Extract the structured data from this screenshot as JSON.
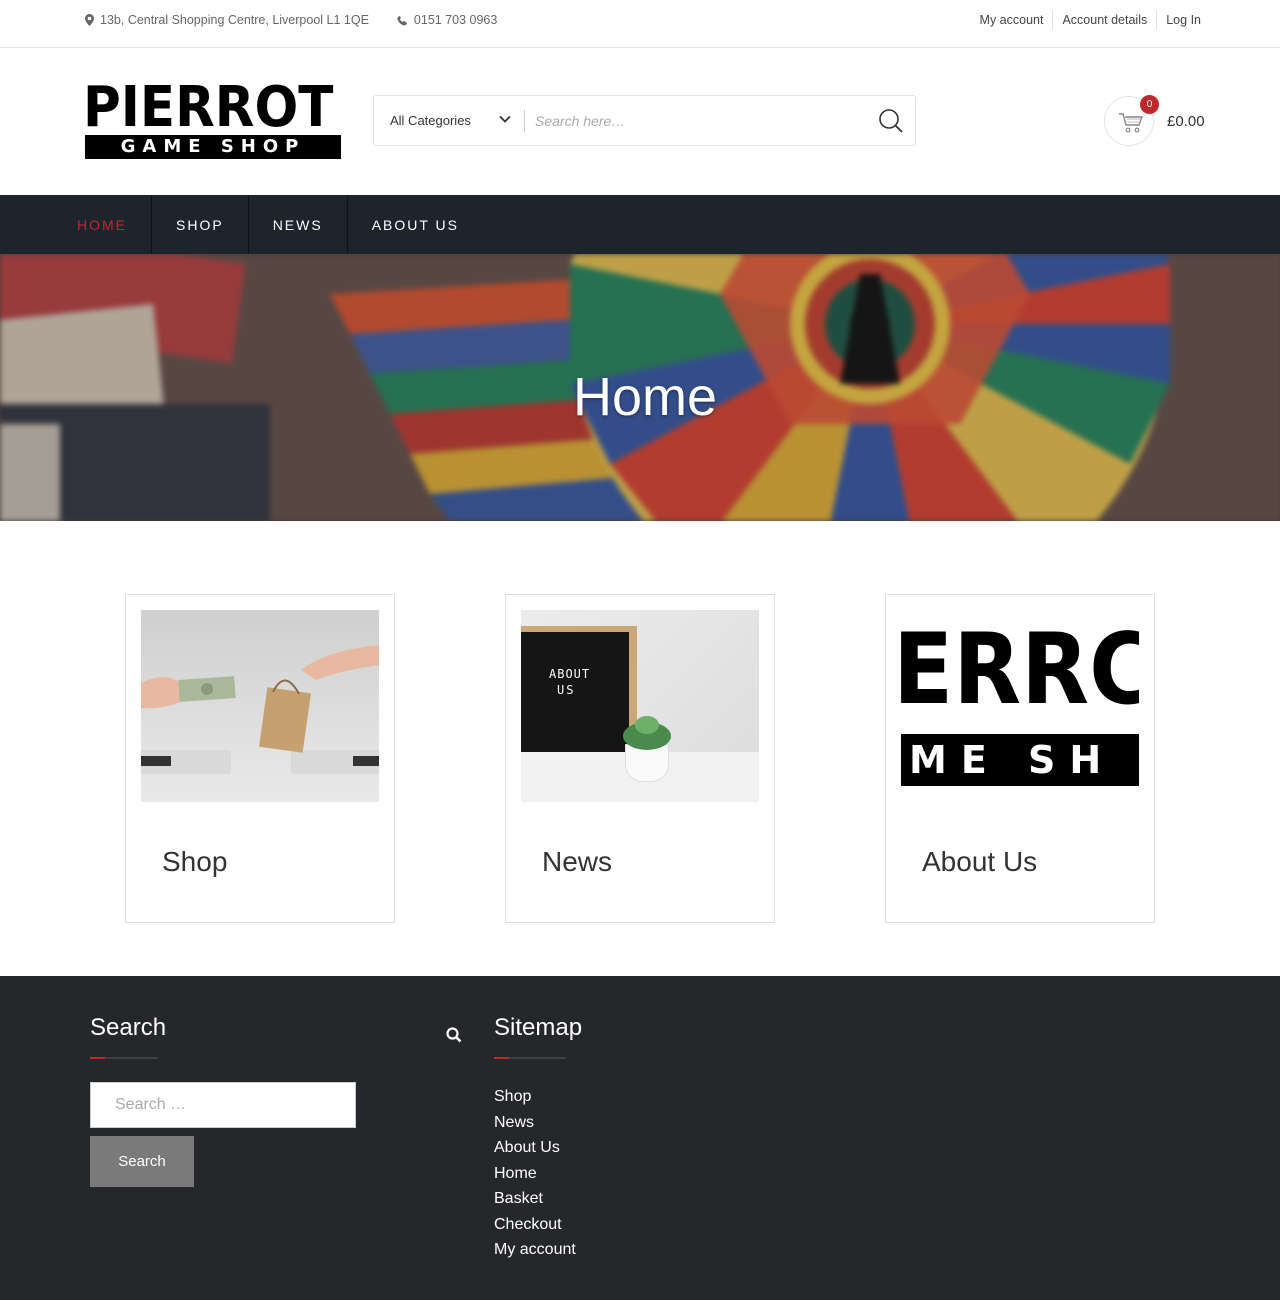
{
  "topbar": {
    "address": "13b, Central Shopping Centre, Liverpool L1 1QE",
    "phone": "0151 703 0963",
    "links": [
      "My account",
      "Account details",
      "Log In"
    ]
  },
  "logo": {
    "line1": "PIERROT",
    "line2": "GAME SHOP"
  },
  "search": {
    "category": "All Categories",
    "placeholder": "Search here…"
  },
  "cart": {
    "count": "0",
    "total": "£0.00"
  },
  "nav": {
    "items": [
      "HOME",
      "SHOP",
      "NEWS",
      "ABOUT US"
    ],
    "active": "HOME"
  },
  "hero": {
    "title": "Home"
  },
  "cards": [
    {
      "label": "Shop"
    },
    {
      "label": "News",
      "image_text_1": "ABOUT",
      "image_text_2": "US"
    },
    {
      "label": "About Us",
      "image_text_1": "ERRC",
      "image_text_2": "ME SH"
    }
  ],
  "footer": {
    "search_title": "Search",
    "search_placeholder": "Search …",
    "search_button": "Search",
    "sitemap_title": "Sitemap",
    "sitemap": [
      "Shop",
      "News",
      "About Us",
      "Home",
      "Basket",
      "Checkout",
      "My account"
    ]
  },
  "colors": {
    "accent": "#c0272d",
    "nav_bg": "#1e242b",
    "footer_bg": "#25272a"
  }
}
